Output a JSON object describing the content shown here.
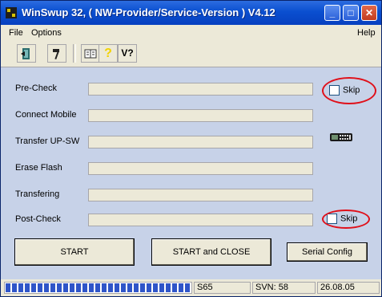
{
  "window": {
    "title": "WinSwup 32, ( NW-Provider/Service-Version ) V4.12",
    "controls": {
      "minimize": "_",
      "maximize": "□",
      "close": "✕"
    }
  },
  "menubar": {
    "file": "File",
    "options": "Options",
    "help": "Help"
  },
  "toolbar": {
    "buttons": [
      {
        "icon": "exit-door-icon"
      },
      {
        "icon": "hammer-icon"
      },
      {
        "icon": "book-icon"
      },
      {
        "icon": "question-icon",
        "label": "?"
      },
      {
        "icon": "version-icon",
        "label": "V?"
      }
    ]
  },
  "steps": {
    "pre_check": {
      "label": "Pre-Check",
      "value": ""
    },
    "connect_mobile": {
      "label": "Connect Mobile",
      "value": ""
    },
    "transfer_up_sw": {
      "label": "Transfer UP-SW",
      "value": ""
    },
    "erase_flash": {
      "label": "Erase Flash",
      "value": ""
    },
    "transfering": {
      "label": "Transfering",
      "value": ""
    },
    "post_check": {
      "label": "Post-Check",
      "value": ""
    }
  },
  "skip_pre": {
    "label": "Skip",
    "checked": false
  },
  "skip_post": {
    "label": "Skip",
    "checked": false
  },
  "buttons": {
    "start": "START",
    "start_close": "START and CLOSE",
    "serial_config": "Serial Config"
  },
  "statusbar": {
    "progress": 1.0,
    "model": "S65",
    "svn": "SVN: 58",
    "date": "26.08.05"
  },
  "colors": {
    "annotation": "#e0101a",
    "progress": "#2f55c8",
    "client_bg": "#c7d2e8"
  }
}
